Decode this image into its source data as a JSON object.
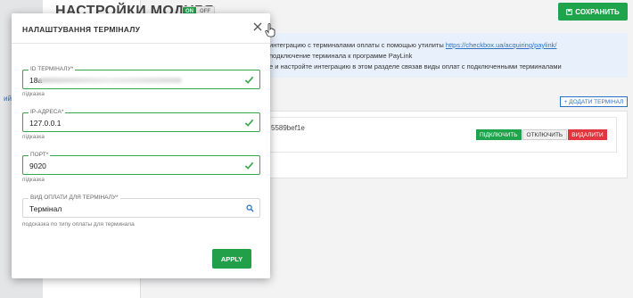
{
  "background": {
    "page_title": "НАСТРОЙКИ МОДУЛЯ",
    "toggle_on": "ON",
    "toggle_off": "OFF",
    "save_label": "СОХРАНИТЬ",
    "left_link": "ий",
    "info_line1_prefix": "интеграцию с терминалами оплаты с помощью утилиты ",
    "info_line1_link": "https://checkbox.ua/acquiring/paylink/",
    "info_line2": "подключение терминала к программе PayLink",
    "info_line3": "е и настройте интеграцию в этом разделе связав виды оплат с подключенными терминалами",
    "add_terminal_label": "+ ДОДАТИ ТЕРМІНАЛ",
    "terminal_id_fragment": "5589bef1e",
    "connect_label": "ПІДКЛЮЧИТЬ",
    "disconnect_label": "ОТКЛЮЧИТЬ",
    "delete_label": "ВИДАЛИТИ"
  },
  "modal": {
    "title": "НАЛАШТУВАННЯ ТЕРМІНАЛУ",
    "fields": [
      {
        "label": "ID ТЕРМІНАЛУ*",
        "value": "18a",
        "hint": "підказка"
      },
      {
        "label": "IP-АДРЕСА*",
        "value": "127.0.0.1",
        "hint": "підказка"
      },
      {
        "label": "ПОРТ*",
        "value": "9020",
        "hint": "підказка"
      },
      {
        "label": "ВИД ОПЛАТИ ДЛЯ ТЕРМІНАЛУ*",
        "value": "Термінал",
        "hint": "подсказка по типу оплаты для терминала"
      }
    ],
    "apply_label": "APPLY"
  },
  "colors": {
    "success": "#22a049",
    "link": "#2b71c9",
    "danger": "#e1363f"
  },
  "icons": {
    "close": "close-icon",
    "check": "check-icon",
    "search": "search-icon",
    "save": "save-icon",
    "cursor": "hand-cursor-icon"
  }
}
